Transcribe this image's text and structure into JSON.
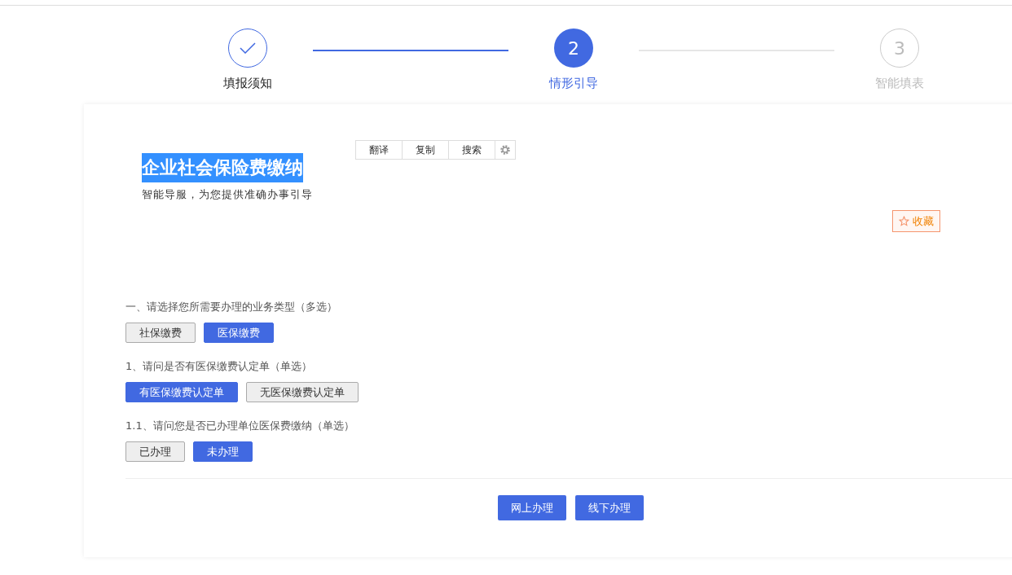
{
  "steps": [
    {
      "label": "填报须知",
      "completed": true,
      "selected": false
    },
    {
      "label": "情形引导",
      "number": "2",
      "completed": false,
      "selected": true
    },
    {
      "label": "智能填表",
      "number": "3",
      "completed": false,
      "selected": false
    }
  ],
  "header": {
    "title": "企业社会保险费缴纳",
    "title_highlighted": true,
    "subtitle": "智能导服，为您提供准确办事引导",
    "favorite": "收藏"
  },
  "selection_popup": {
    "actions": [
      "翻译",
      "复制",
      "搜索"
    ]
  },
  "questions": [
    {
      "text": "一、请选择您所需要办理的业务类型（多选）",
      "options": [
        {
          "label": "社保缴费",
          "selected": false
        },
        {
          "label": "医保缴费",
          "selected": true
        }
      ]
    },
    {
      "text": "1、请问是否有医保缴费认定单（单选）",
      "options": [
        {
          "label": "有医保缴费认定单",
          "selected": true
        },
        {
          "label": "无医保缴费认定单",
          "selected": false
        }
      ]
    },
    {
      "text": "1.1、请问您是否已办理单位医保费缴纳（单选）",
      "options": [
        {
          "label": "已办理",
          "selected": false
        },
        {
          "label": "未办理",
          "selected": true
        }
      ]
    }
  ],
  "actions": [
    "网上办理",
    "线下办理"
  ]
}
